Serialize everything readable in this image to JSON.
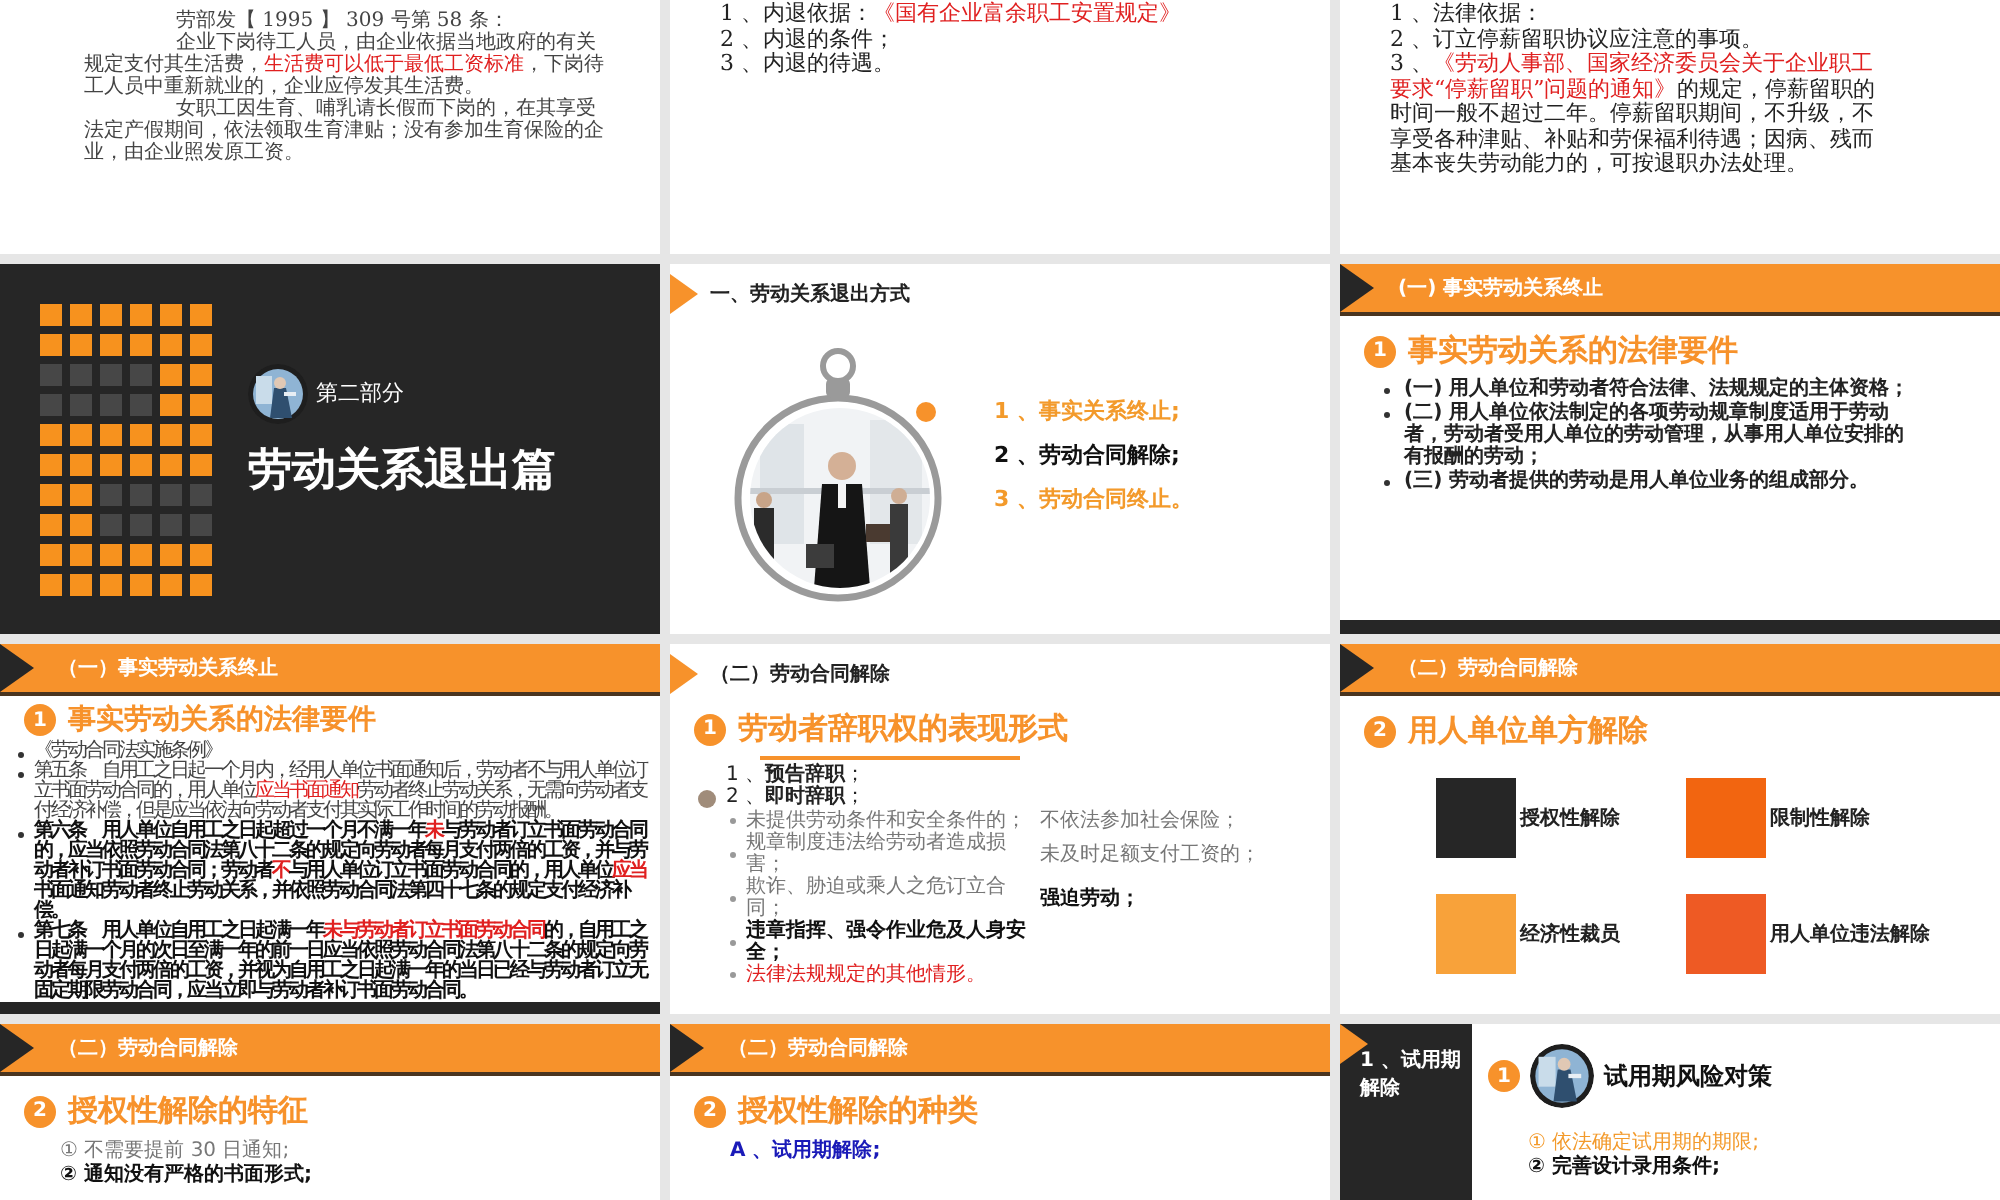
{
  "slides": [
    {
      "kind": "memo",
      "paragraphs": [
        {
          "runs": [
            {
              "text": "劳部发【 1995 】 309 号第 58 条：",
              "emphasis": false
            }
          ]
        },
        {
          "runs": [
            {
              "text": "企业下岗待工人员，由企业依据当地政府的有关规定支付其生活费，",
              "emphasis": false
            },
            {
              "text": "生活费可以低于最低工资标准",
              "emphasis": true
            },
            {
              "text": "，下岗待工人员中重新就业的，企业应停发其生活费。",
              "emphasis": false
            }
          ]
        },
        {
          "runs": [
            {
              "text": "女职工因生育、哺乳请长假而下岗的，在其享受法定产假期间，依法领取生育津贴；没有参加生育保险的企业，由企业照发原工资。",
              "emphasis": false
            }
          ]
        }
      ]
    },
    {
      "kind": "list",
      "paragraphs": [
        {
          "runs": [
            {
              "text": "1 、内退依据：",
              "emphasis": false
            },
            {
              "text": "《国有企业富余职工安置规定》",
              "emphasis": true
            }
          ]
        },
        {
          "runs": [
            {
              "text": "2 、内退的条件；",
              "emphasis": false
            }
          ]
        },
        {
          "runs": [
            {
              "text": "3 、内退的待遇。",
              "emphasis": false
            }
          ]
        }
      ]
    },
    {
      "kind": "list",
      "paragraphs": [
        {
          "runs": [
            {
              "text": "1 、法律依据：",
              "emphasis": false
            }
          ]
        },
        {
          "runs": [
            {
              "text": "2 、订立停薪留职协议应注意的事项。",
              "emphasis": false
            }
          ]
        },
        {
          "runs": [
            {
              "text": "3 、",
              "emphasis": false
            },
            {
              "text": "《劳动人事部、国家经济委员会关于企业职工要求“停薪留职”问题的通知》",
              "emphasis": true
            },
            {
              "text": "的规定，停薪留职的时间一般不超过二年。停薪留职期间，不升级，不享受各种津贴、补贴和劳保福利待遇；因病、残而基本丧失劳动能力的，可按退职办法处理。",
              "emphasis": false
            }
          ]
        }
      ]
    },
    {
      "kind": "section",
      "part": "第二部分",
      "title": "劳动关系退出篇"
    },
    {
      "kind": "overview",
      "header": {
        "kind": "plain",
        "text": "一、劳动关系退出方式"
      },
      "items": [
        {
          "text": "1 、事实关系终止;",
          "color": "#f39a2b"
        },
        {
          "text": "2 、劳动合同解除;",
          "color": "#111111"
        },
        {
          "text": "3 、劳动合同终止。",
          "color": "#f39a2b"
        }
      ]
    },
    {
      "kind": "requirements",
      "header": {
        "kind": "bar",
        "text": "(一) 事实劳动关系终止"
      },
      "number": "1",
      "heading": "事实劳动关系的法律要件",
      "paragraphs": [
        {
          "runs": [
            {
              "text": "(一) 用人单位和劳动者符合法律、法规规定的主体资格；",
              "emphasis": false
            }
          ],
          "bold": true
        },
        {
          "runs": [
            {
              "text": "(二) 用人单位依法制定的各项劳动规章制度适用于劳动者，劳动者受用人单位的劳动管理，从事用人单位安排的有报酬的劳动；",
              "emphasis": false
            }
          ],
          "bold": true
        },
        {
          "runs": [
            {
              "text": "(三) 劳动者提供的劳动是用人单位业务的组成部分。",
              "emphasis": false
            }
          ],
          "bold": true
        }
      ]
    },
    {
      "kind": "statute",
      "header": {
        "kind": "bar",
        "text": "（一）事实劳动关系终止"
      },
      "number": "1",
      "heading": "事实劳动关系的法律要件",
      "paragraphs": [
        {
          "runs": [
            {
              "text": "《劳动合同法实施条例》",
              "emphasis": false
            }
          ],
          "bold": false
        },
        {
          "runs": [
            {
              "text": "第五条　自用工之日起一个月内，经用人单位书面通知后，劳动者不与用人单位订立书面劳动合同的，用人单位",
              "emphasis": false
            },
            {
              "text": "应当书面通知",
              "emphasis": true
            },
            {
              "text": "劳动者终止劳动关系，无需向劳动者支付经济补偿，但是应当依法向劳动者支付其实际工作时间的劳动报酬。",
              "emphasis": false
            }
          ],
          "bold": false
        },
        {
          "runs": [
            {
              "text": "第六条　用人单位自用工之日起超过一个月不满一年",
              "emphasis": false
            },
            {
              "text": "未",
              "emphasis": true
            },
            {
              "text": "与劳动者订立书面劳动合同的，应当依照劳动合同法第八十二条的规定向劳动者每月支付两倍的工资，并与劳动者补订书面劳动合同；劳动者",
              "emphasis": false
            },
            {
              "text": "不",
              "emphasis": true
            },
            {
              "text": "与用人单位订立书面劳动合同的，用人单位",
              "emphasis": false
            },
            {
              "text": "应当",
              "emphasis": true
            },
            {
              "text": "书面通知劳动者终止劳动关系，并依照劳动合同法第四十七条的规定支付经济补偿。",
              "emphasis": false
            }
          ],
          "bold": true
        },
        {
          "runs": [
            {
              "text": "第七条　用人单位自用工之日起满一年",
              "emphasis": false
            },
            {
              "text": "未与劳动者订立书面劳动合同",
              "emphasis": true
            },
            {
              "text": "的，自用工之日起满一个月的次日至满一年的前一日应当依照劳动合同法第八十二条的规定向劳动者每月支付两倍的工资，并视为自用工之日起满一年的当日已经与劳动者订立无固定期限劳动合同，应当立即与劳动者补订书面劳动合同。",
              "emphasis": false
            }
          ],
          "bold": true
        }
      ]
    },
    {
      "kind": "resign",
      "header": {
        "kind": "plain",
        "text": "（二）劳动合同解除"
      },
      "number": "1",
      "heading": "劳动者辞职权的表现形式",
      "forms": [
        "1 、**预告辞职**；",
        "2 、**即时辞职**；"
      ],
      "grounds": [
        {
          "cells": [
            {
              "text": "未提供劳动条件和安全条件的；",
              "kind": "muted"
            },
            {
              "text": "不依法参加社会保险；",
              "kind": "muted"
            }
          ]
        },
        {
          "cells": [
            {
              "text": "规章制度违法给劳动者造成损害；",
              "kind": "muted"
            },
            {
              "text": "未及时足额支付工资的；",
              "kind": "muted"
            }
          ]
        },
        {
          "cells": [
            {
              "text": "欺诈、胁迫或乘人之危订立合同；",
              "kind": "muted"
            },
            {
              "text": "强迫劳动；",
              "kind": "strong"
            }
          ]
        },
        {
          "cells": [
            {
              "text": "违章指挥、强令作业危及人身安全；",
              "kind": "strong"
            }
          ]
        },
        {
          "cells": [
            {
              "text": "法律法规规定的其他情形。",
              "kind": "alert"
            }
          ]
        }
      ]
    },
    {
      "kind": "options",
      "header": {
        "kind": "bar",
        "text": "（二）劳动合同解除"
      },
      "number": "2",
      "heading": "用人单位单方解除",
      "options": [
        {
          "label": "授权性解除",
          "color": "#262626"
        },
        {
          "label": "限制性解除",
          "color": "#f26510"
        },
        {
          "label": "经济性裁员",
          "color": "#f8a23a"
        },
        {
          "label": "用人单位违法解除",
          "color": "#ee5a24"
        }
      ]
    },
    {
      "kind": "points",
      "header": {
        "kind": "bar",
        "text": "（二）劳动合同解除"
      },
      "number": "2",
      "heading": "授权性解除的特征",
      "points": [
        {
          "text": "① 不需要提前 30 日通知;",
          "kind": "muted"
        },
        {
          "text": "② 通知没有严格的书面形式;",
          "kind": "strong"
        }
      ]
    },
    {
      "kind": "points",
      "header": {
        "kind": "bar",
        "text": "（二）劳动合同解除"
      },
      "number": "2",
      "heading": "授权性解除的种类",
      "points": [
        {
          "text": "A 、试用期解除;",
          "kind": "link"
        }
      ]
    },
    {
      "kind": "strategy",
      "panel_title": "1 、试用期解除",
      "number": "1",
      "heading": "试用期风险对策",
      "points": [
        {
          "text": "① 依法确定试用期的期限;",
          "kind": "accent"
        },
        {
          "text": "② 完善设计录用条件;",
          "kind": "strong"
        }
      ]
    }
  ]
}
